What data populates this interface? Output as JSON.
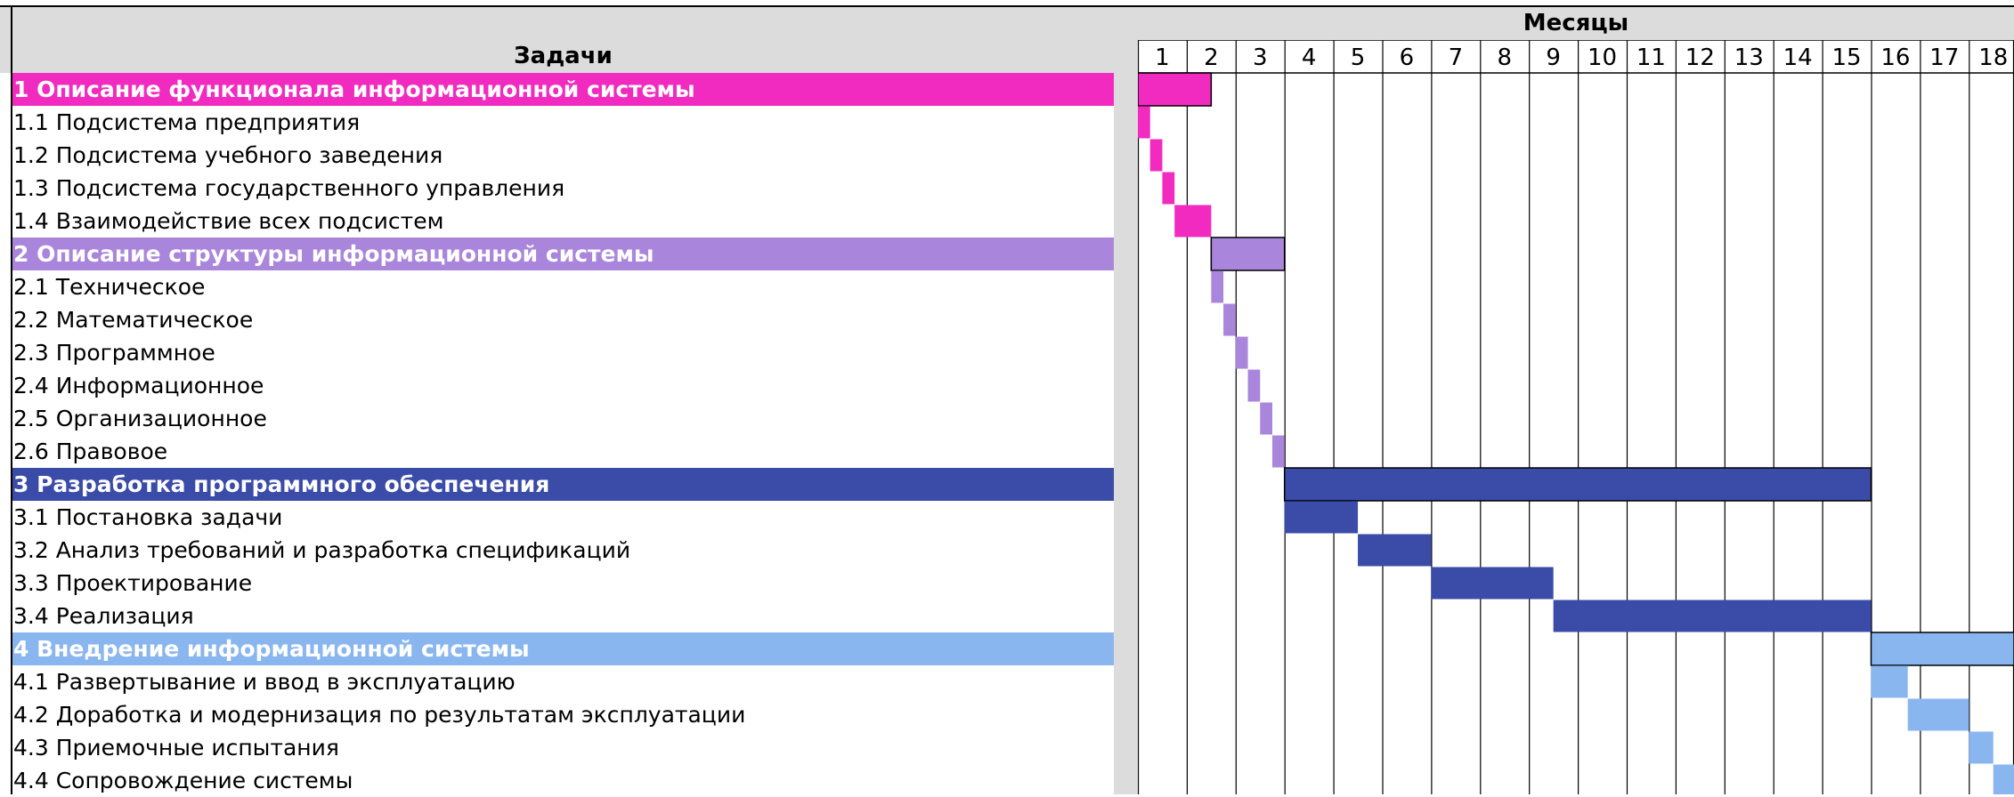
{
  "header": {
    "tasks_title": "Задачи",
    "months_title": "Месяцы"
  },
  "months": [
    "1",
    "2",
    "3",
    "4",
    "5",
    "6",
    "7",
    "8",
    "9",
    "10",
    "11",
    "12",
    "13",
    "14",
    "15",
    "16",
    "17",
    "18"
  ],
  "colors": {
    "group1": "#f22bc0",
    "group2": "#a986db",
    "group3": "#3a4ba8",
    "group4": "#8ab6ef",
    "header_band": "#dcdcdc",
    "grid": "#000000"
  },
  "chart_data": {
    "type": "gantt",
    "x_unit": "месяцы",
    "xlim": [
      0,
      18
    ],
    "tasks": [
      {
        "name": "1 Описание функционала информационной системы",
        "group": true,
        "color_key": "group1",
        "start": 0,
        "end": 1.5
      },
      {
        "name": "1.1 Подсистема предприятия",
        "group": false,
        "color_key": "group1",
        "start": 0,
        "end": 0.25
      },
      {
        "name": "1.2 Подсистема учебного заведения",
        "group": false,
        "color_key": "group1",
        "start": 0.25,
        "end": 0.5
      },
      {
        "name": "1.3 Подсистема государственного управления",
        "group": false,
        "color_key": "group1",
        "start": 0.5,
        "end": 0.75
      },
      {
        "name": "1.4 Взаимодействие всех подсистем",
        "group": false,
        "color_key": "group1",
        "start": 0.75,
        "end": 1.5
      },
      {
        "name": "2 Описание структуры информационной системы",
        "group": true,
        "color_key": "group2",
        "start": 1.5,
        "end": 3
      },
      {
        "name": "2.1 Техническое",
        "group": false,
        "color_key": "group2",
        "start": 1.5,
        "end": 1.75
      },
      {
        "name": "2.2 Математическое",
        "group": false,
        "color_key": "group2",
        "start": 1.75,
        "end": 2
      },
      {
        "name": "2.3 Программное",
        "group": false,
        "color_key": "group2",
        "start": 2,
        "end": 2.25
      },
      {
        "name": "2.4 Информационное",
        "group": false,
        "color_key": "group2",
        "start": 2.25,
        "end": 2.5
      },
      {
        "name": "2.5 Организационное",
        "group": false,
        "color_key": "group2",
        "start": 2.5,
        "end": 2.75
      },
      {
        "name": "2.6 Правовое",
        "group": false,
        "color_key": "group2",
        "start": 2.75,
        "end": 3
      },
      {
        "name": "3 Разработка программного обеспечения",
        "group": true,
        "color_key": "group3",
        "start": 3,
        "end": 15
      },
      {
        "name": "3.1 Постановка задачи",
        "group": false,
        "color_key": "group3",
        "start": 3,
        "end": 4.5
      },
      {
        "name": "3.2 Анализ требований и разработка спецификаций",
        "group": false,
        "color_key": "group3",
        "start": 4.5,
        "end": 6
      },
      {
        "name": "3.3 Проектирование",
        "group": false,
        "color_key": "group3",
        "start": 6,
        "end": 8.5
      },
      {
        "name": "3.4 Реализация",
        "group": false,
        "color_key": "group3",
        "start": 8.5,
        "end": 15
      },
      {
        "name": "4 Внедрение информационной системы",
        "group": true,
        "color_key": "group4",
        "start": 15,
        "end": 18
      },
      {
        "name": "4.1 Развертывание и ввод в эксплуатацию",
        "group": false,
        "color_key": "group4",
        "start": 15,
        "end": 15.75
      },
      {
        "name": "4.2 Доработка и модернизация по результатам эксплуатации",
        "group": false,
        "color_key": "group4",
        "start": 15.75,
        "end": 17
      },
      {
        "name": "4.3 Приемочные испытания",
        "group": false,
        "color_key": "group4",
        "start": 17,
        "end": 17.5
      },
      {
        "name": "4.4 Сопровождение системы",
        "group": false,
        "color_key": "group4",
        "start": 17.5,
        "end": 18
      }
    ]
  }
}
